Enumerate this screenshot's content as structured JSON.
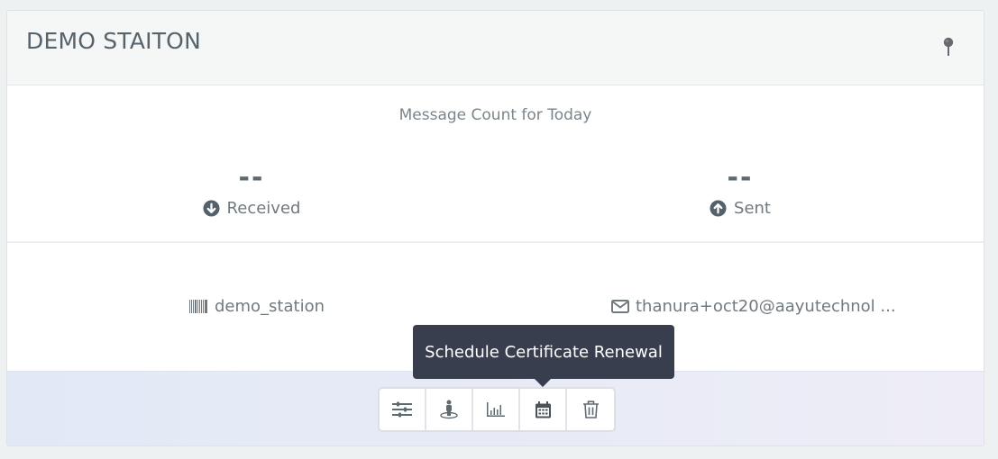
{
  "card": {
    "title": "DEMO STAITON",
    "pin_icon": "map-pin-icon"
  },
  "message_count": {
    "title": "Message Count for Today",
    "received": {
      "value": "--",
      "label": "Received",
      "icon": "arrow-circle-down-icon"
    },
    "sent": {
      "value": "--",
      "label": "Sent",
      "icon": "arrow-circle-up-icon"
    }
  },
  "info": {
    "station_id": {
      "icon": "barcode-icon",
      "value": "demo_station"
    },
    "email": {
      "icon": "envelope-icon",
      "value": "thanura+oct20@aayutechnol ..."
    }
  },
  "toolbar": {
    "buttons": [
      {
        "name": "settings",
        "icon": "sliders-icon"
      },
      {
        "name": "location",
        "icon": "street-view-icon"
      },
      {
        "name": "statistics",
        "icon": "bar-chart-icon"
      },
      {
        "name": "schedule-certificate-renewal",
        "icon": "calendar-icon"
      },
      {
        "name": "delete",
        "icon": "trash-icon"
      }
    ]
  },
  "tooltip": {
    "text": "Schedule Certificate Renewal"
  },
  "colors": {
    "tooltip_bg": "#393e4f",
    "icon_gray": "#5f6a70",
    "title_text": "#56636b"
  }
}
